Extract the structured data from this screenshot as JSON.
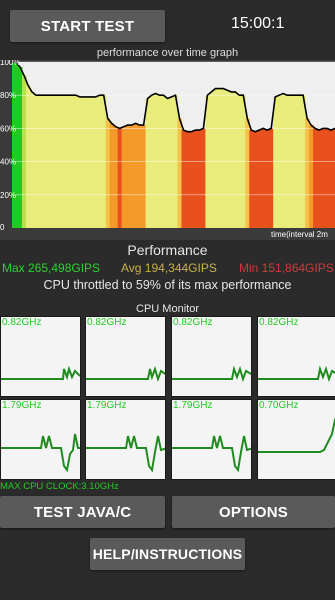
{
  "header": {
    "start_label": "START TEST",
    "timer": "15:00:1"
  },
  "graph": {
    "title": "performance over time graph",
    "x_label": "time(interval 2m",
    "y_ticks": [
      "100%",
      "80%",
      "60%",
      "40%",
      "20%",
      "0"
    ]
  },
  "performance": {
    "title": "Performance",
    "max": "Max 265,498GIPS",
    "avg": "Avg 194,344GIPS",
    "min": "Min 151,864GIPS",
    "throttle": "CPU throttled to 59% of its max performance"
  },
  "monitor": {
    "title": "CPU Monitor",
    "cells": [
      {
        "freq": "0.82GHz"
      },
      {
        "freq": "0.82GHz"
      },
      {
        "freq": "0.82GHz"
      },
      {
        "freq": "0.82GHz"
      },
      {
        "freq": "1.79GHz"
      },
      {
        "freq": "1.79GHz"
      },
      {
        "freq": "1.79GHz"
      },
      {
        "freq": "0.70GHz"
      }
    ],
    "max_clock": "MAX CPU CLOCK:3.10GHz"
  },
  "buttons": {
    "java": "TEST JAVA/C",
    "options": "OPTIONS",
    "help": "HELP/INSTRUCTIONS"
  },
  "colors": {
    "max": "#2fd12f",
    "avg": "#c8b04a",
    "min": "#d13a3a",
    "cpu_line": "#1e8c1e",
    "button": "#5a5a5a"
  },
  "chart_data": {
    "type": "area",
    "title": "performance over time graph",
    "xlabel": "time(interval 2m",
    "ylabel": "",
    "ylim": [
      0,
      100
    ],
    "series": [
      {
        "values": [
          100,
          100,
          97,
          92,
          86,
          82,
          80,
          80,
          80,
          80,
          80,
          80,
          80,
          80,
          80,
          80,
          80,
          79,
          79,
          79,
          79,
          79,
          80,
          80,
          66,
          63,
          61,
          60,
          61,
          62,
          62,
          63,
          62,
          62,
          78,
          80,
          81,
          80,
          80,
          78,
          79,
          80,
          66,
          59,
          58,
          58,
          59,
          59,
          60,
          80,
          82,
          84,
          84,
          84,
          83,
          82,
          82,
          80,
          80,
          66,
          59,
          58,
          59,
          60,
          59,
          60,
          79,
          80,
          81,
          80,
          80,
          80,
          80,
          80,
          66,
          62,
          60,
          59,
          60,
          60,
          59,
          60
        ]
      }
    ]
  }
}
